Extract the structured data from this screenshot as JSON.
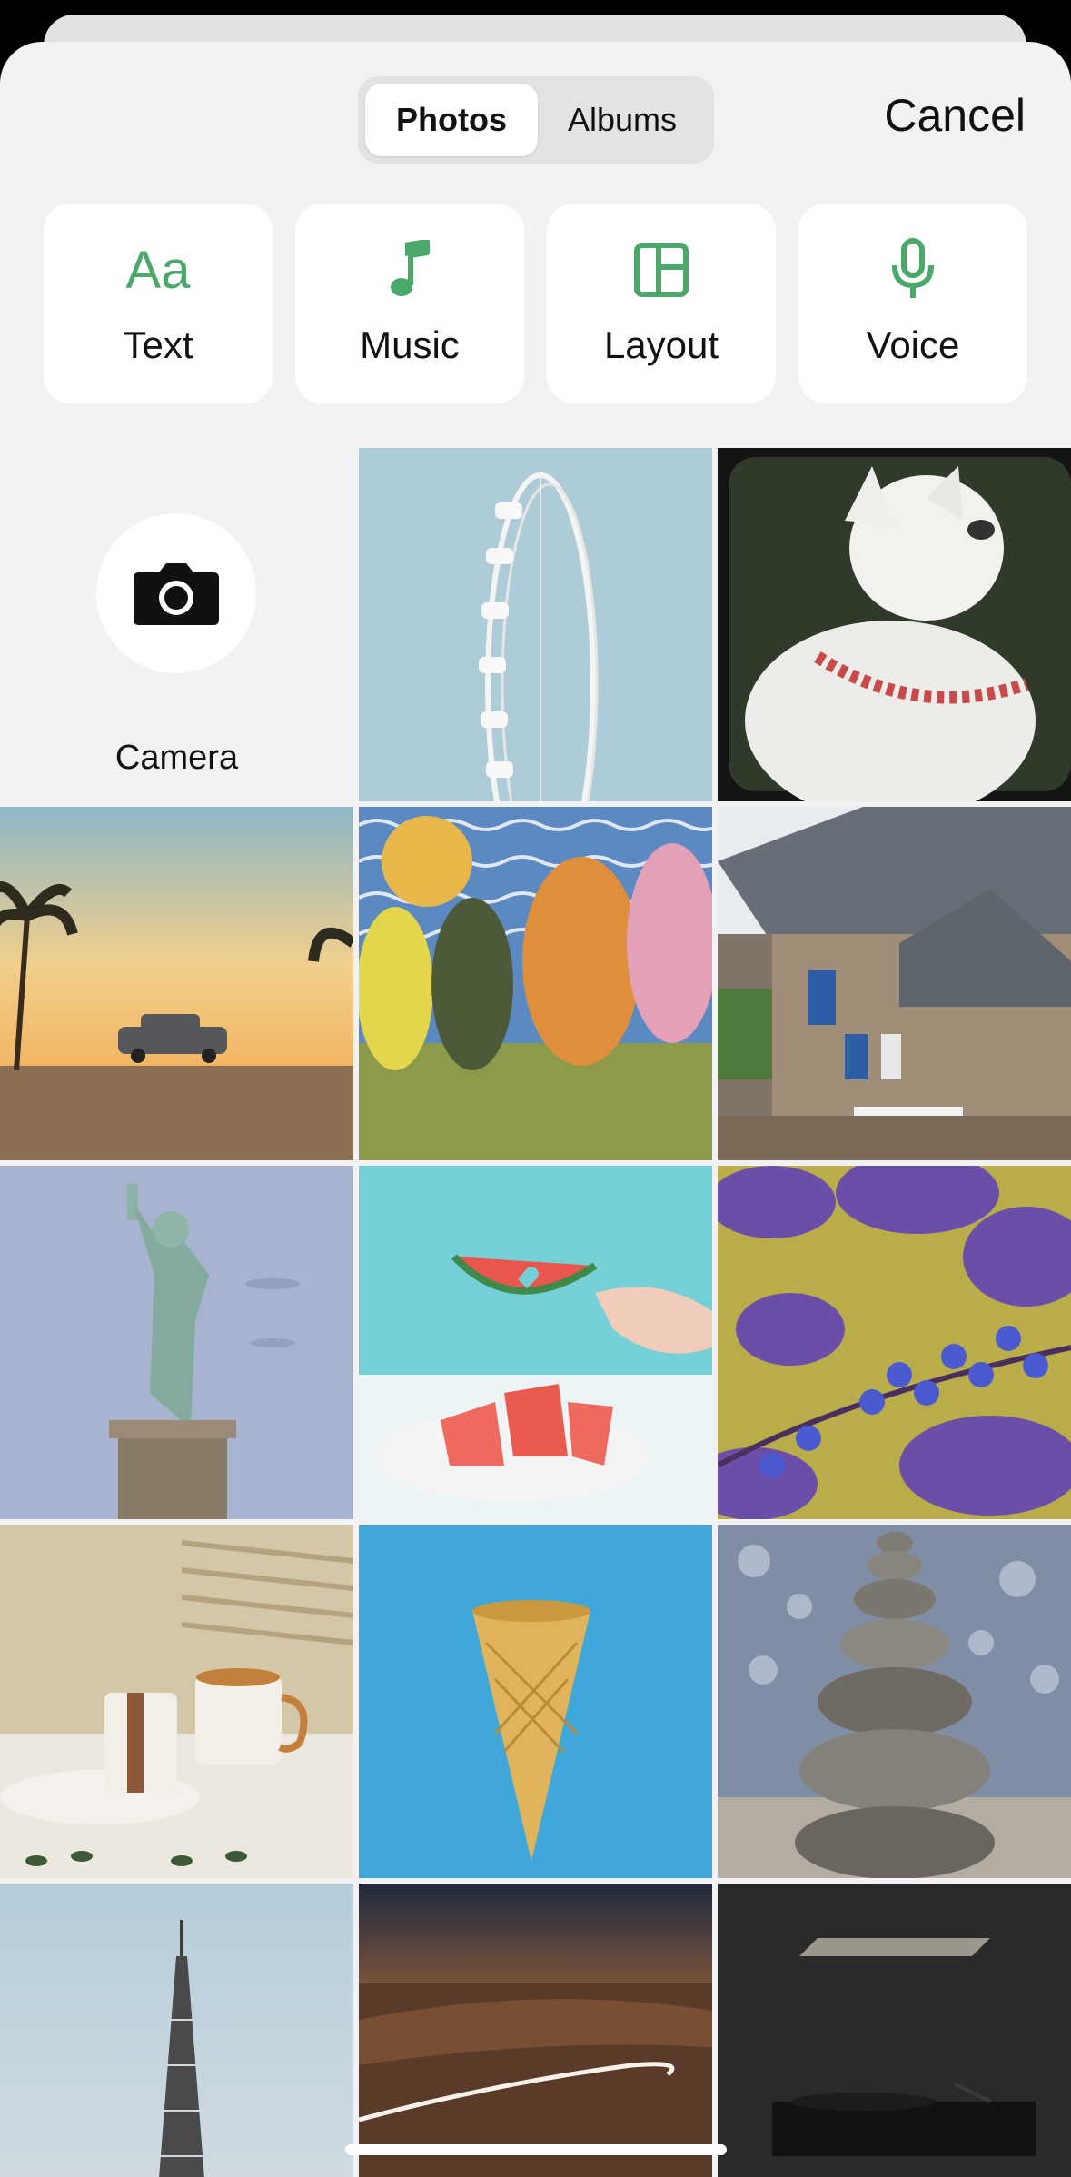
{
  "header": {
    "tabs": [
      {
        "label": "Photos",
        "selected": true
      },
      {
        "label": "Albums",
        "selected": false
      }
    ],
    "cancel_label": "Cancel"
  },
  "tools": [
    {
      "label": "Text",
      "icon": "text-aa-icon",
      "glyph": "Aa"
    },
    {
      "label": "Music",
      "icon": "music-note-icon"
    },
    {
      "label": "Layout",
      "icon": "layout-grid-icon"
    },
    {
      "label": "Voice",
      "icon": "microphone-icon"
    }
  ],
  "camera": {
    "label": "Camera",
    "icon": "camera-icon"
  },
  "colors": {
    "accent": "#4aa86a",
    "sheet": "#f2f2f4",
    "card": "#ffffff"
  },
  "photos": [
    "ferris-wheel",
    "white-dog-in-car",
    "vintage-car-palms-sunset",
    "illustrated-trees",
    "stone-cottage",
    "statue-of-liberty",
    "watermelon-pool",
    "purple-leaves-berries",
    "coffee-cups-table",
    "ice-cream-cone",
    "stacked-stones",
    "eiffel-tower",
    "canyon-light-trail",
    "dark-turntable"
  ]
}
